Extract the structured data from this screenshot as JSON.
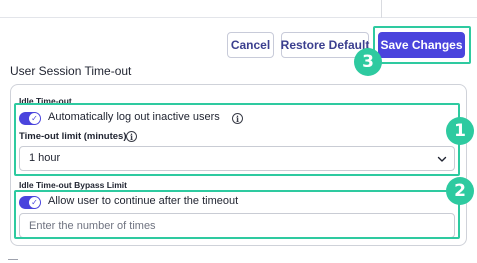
{
  "toolbar": {
    "cancel_label": "Cancel",
    "restore_label": "Restore Default",
    "save_label": "Save Changes"
  },
  "section": {
    "title": "User Session Time-out"
  },
  "idle_timeout": {
    "heading": "Idle Time-out",
    "auto_logout_label": "Automatically log out inactive users",
    "auto_logout_enabled": true,
    "limit_label": "Time-out limit (minutes)",
    "limit_value": "1 hour"
  },
  "bypass_limit": {
    "heading": "Idle Time-out Bypass Limit",
    "allow_continue_label": "Allow user to continue after the timeout",
    "allow_continue_enabled": true,
    "times_placeholder": "Enter the number of times"
  },
  "callouts": {
    "one": "1",
    "two": "2",
    "three": "3"
  },
  "icons": {
    "info": "info-icon",
    "chevron": "chevron-down-icon",
    "check": "check-icon"
  },
  "colors": {
    "accent": "#4a44dd",
    "callout": "#2ecaa0",
    "border": "#cfd2d9"
  }
}
